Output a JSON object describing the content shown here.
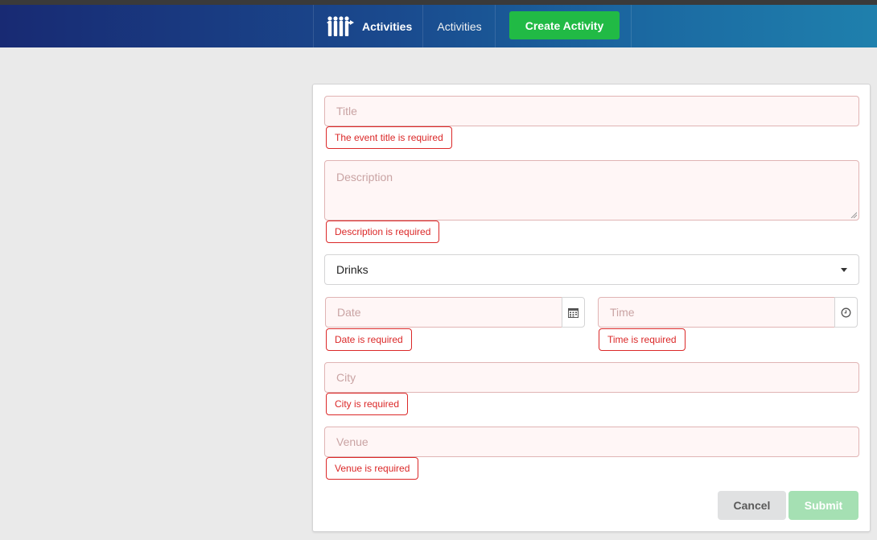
{
  "nav": {
    "brand_label": "Activities",
    "link_label": "Activities",
    "create_label": "Create Activity"
  },
  "form": {
    "title": {
      "placeholder": "Title",
      "error": "The event title is required"
    },
    "description": {
      "placeholder": "Description",
      "error": "Description is required"
    },
    "category": {
      "selected": "Drinks"
    },
    "date": {
      "placeholder": "Date",
      "error": "Date is required"
    },
    "time": {
      "placeholder": "Time",
      "error": "Time is required"
    },
    "city": {
      "placeholder": "City",
      "error": "City is required"
    },
    "venue": {
      "placeholder": "Venue",
      "error": "Venue is required"
    },
    "cancel_label": "Cancel",
    "submit_label": "Submit"
  },
  "icons": {
    "brand": "people-group-icon",
    "date": "calendar-icon",
    "time": "clock-icon",
    "category": "caret-down-icon"
  },
  "colors": {
    "primary": "#21ba45",
    "error": "#db2828",
    "error_bg": "#fff6f6",
    "error_border": "#e0b4b4"
  }
}
